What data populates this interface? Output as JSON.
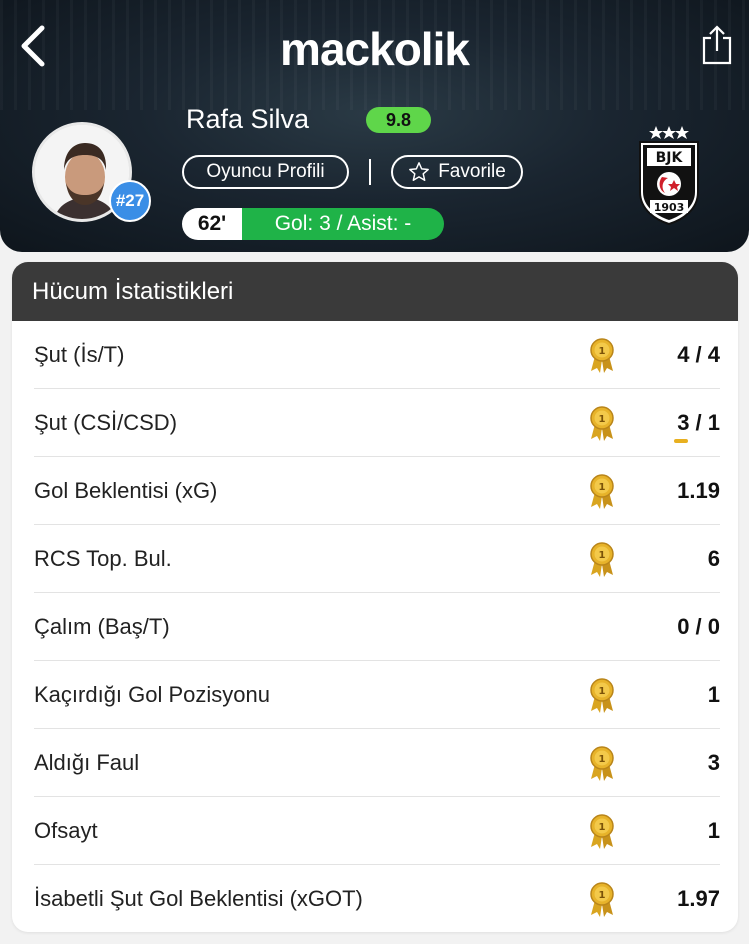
{
  "header": {
    "logo": "mackolik",
    "player_name": "Rafa Silva",
    "rating": "9.8",
    "shirt_number": "#27",
    "profile_button": "Oyuncu Profili",
    "favorite_button": "Favorile",
    "minute": "62'",
    "goals_assists": "Gol: 3 / Asist: -",
    "club_badge_text": "BJK 1903"
  },
  "stats": {
    "title": "Hücum İstatistikleri",
    "rows": [
      {
        "label": "Şut (İs/T)",
        "value": "4 / 4",
        "medal": true
      },
      {
        "label": "Şut (CSİ/CSD)",
        "value": "3 / 1",
        "medal": true
      },
      {
        "label": "Gol Beklentisi (xG)",
        "value": "1.19",
        "medal": true
      },
      {
        "label": "RCS Top. Bul.",
        "value": "6",
        "medal": true
      },
      {
        "label": "Çalım (Baş/T)",
        "value": "0 / 0",
        "medal": false
      },
      {
        "label": "Kaçırdığı Gol Pozisyonu",
        "value": "1",
        "medal": true
      },
      {
        "label": "Aldığı Faul",
        "value": "3",
        "medal": true
      },
      {
        "label": "Ofsayt",
        "value": "1",
        "medal": true
      },
      {
        "label": "İsabetli Şut Gol Beklentisi (xGOT)",
        "value": "1.97",
        "medal": true
      }
    ]
  },
  "icons": {
    "back": "chevron-left-icon",
    "share": "share-icon",
    "favorite": "star-outline-icon",
    "medal": "gold-medal-icon"
  },
  "colors": {
    "rating_bg": "#5fd64a",
    "goals_bg": "#1fb348",
    "number_badge": "#3a8ee6",
    "card_header_bg": "#3a3a3a",
    "medal_gold": "#d9a520"
  }
}
